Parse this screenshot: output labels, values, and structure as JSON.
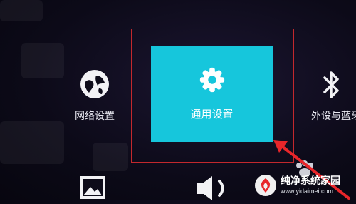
{
  "settings_menu": {
    "items": [
      {
        "label": "网络设置",
        "icon": "globe-icon"
      },
      {
        "label": "通用设置",
        "icon": "gear-icon",
        "focused": true
      },
      {
        "label": "外设与蓝牙",
        "icon": "bluetooth-icon"
      },
      {
        "label": "",
        "icon": "image-icon"
      },
      {
        "label": "",
        "icon": "speaker-icon"
      },
      {
        "label": "",
        "icon": "paw-icon"
      }
    ]
  },
  "colors": {
    "focus_tile": "#16c6dc",
    "highlight_frame": "#c3282d",
    "arrow": "#e8262a"
  },
  "watermark": {
    "title": "纯净系统家园",
    "url": "www.yidaimei.com"
  }
}
